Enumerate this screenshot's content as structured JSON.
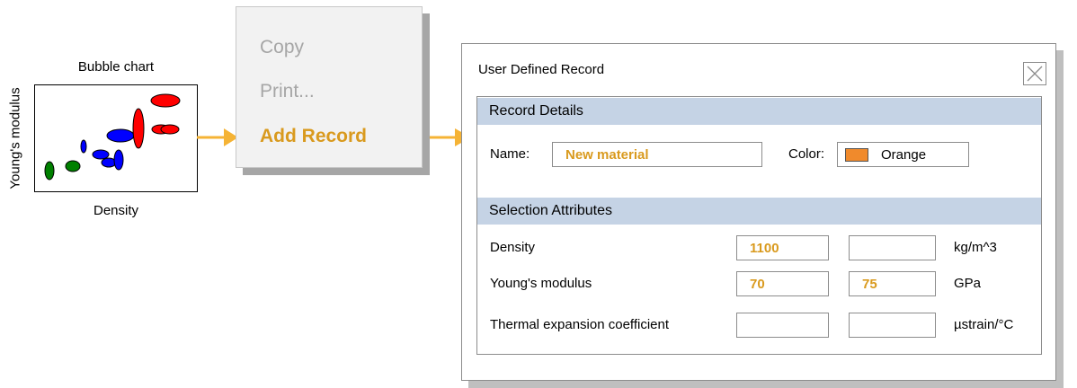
{
  "chart": {
    "title": "Bubble chart",
    "xlabel": "Density",
    "ylabel": "Young's modulus",
    "colors": {
      "red": "#ff0000",
      "blue": "#0000ff",
      "green": "#008000"
    }
  },
  "menu": {
    "copy": "Copy",
    "print": "Print...",
    "add_record": "Add Record",
    "accent": "#d99a1e"
  },
  "dialog": {
    "title": "User Defined Record",
    "record_details": "Record Details",
    "name_label": "Name:",
    "name_value": "New material",
    "color_label": "Color:",
    "color_value": "Orange",
    "color_swatch": "#f08a2c",
    "selection_attributes": "Selection Attributes",
    "attributes": [
      {
        "label": "Density",
        "min": "1100",
        "max": "",
        "unit": "kg/m^3"
      },
      {
        "label": "Young's modulus",
        "min": "70",
        "max": "75",
        "unit": "GPa"
      },
      {
        "label": "Thermal expansion coefficient",
        "min": "",
        "max": "",
        "unit": "µstrain/°C"
      }
    ]
  }
}
